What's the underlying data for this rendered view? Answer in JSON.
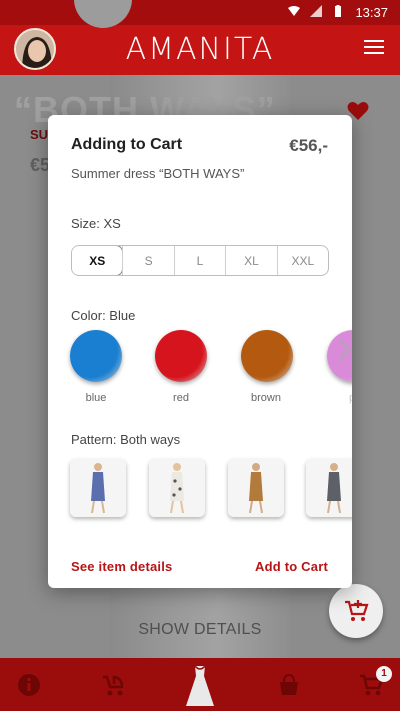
{
  "status_bar": {
    "time": "13:37"
  },
  "app_bar": {
    "brand": "AMANITA"
  },
  "background_page": {
    "title": "“BOTH WAYS”",
    "subtitle": "SU",
    "price": "€5",
    "show_details": "SHOW DETAILS"
  },
  "modal": {
    "title": "Adding to Cart",
    "price": "€56,-",
    "subtitle": "Summer dress “BOTH WAYS”",
    "size_label": "Size: XS",
    "sizes": [
      "XS",
      "S",
      "L",
      "XL",
      "XXL"
    ],
    "selected_size": "XS",
    "color_label": "Color: Blue",
    "colors": [
      {
        "name": "blue",
        "hex": "#1a7fd0"
      },
      {
        "name": "red",
        "hex": "#d6141d"
      },
      {
        "name": "brown",
        "hex": "#b45a10"
      },
      {
        "name": "p",
        "hex": "#d98ad8"
      }
    ],
    "pattern_label": "Pattern: Both ways",
    "patterns": [
      "blue-dress",
      "floral-dress",
      "brown-dress",
      "grey-dress"
    ],
    "see_details": "See item details",
    "add_to_cart": "Add to Cart"
  },
  "bottom_nav": {
    "items": [
      "info-icon",
      "stroller-icon",
      "dress-icon",
      "bag-icon",
      "cart-icon"
    ],
    "cart_badge": "1"
  },
  "colors": {
    "brand_red": "#c41414",
    "accent_red": "#b71515"
  }
}
